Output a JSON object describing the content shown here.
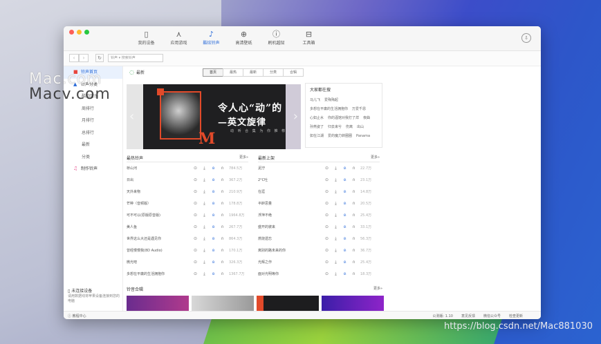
{
  "watermark": {
    "line1": "Mac.com",
    "line2": "Macv.com",
    "csdn": "https://blog.csdn.net/Mac881030"
  },
  "colors": {
    "accent": "#2a6bd9",
    "red": "#e24a2a"
  },
  "nav": [
    {
      "label": "我的设备",
      "icon": "phone-icon"
    },
    {
      "label": "应用游戏",
      "icon": "apps-icon"
    },
    {
      "label": "酷炫铃声",
      "icon": "music-note-icon",
      "active": true
    },
    {
      "label": "高清壁纸",
      "icon": "wallpaper-icon"
    },
    {
      "label": "刷机越狱",
      "icon": "flash-icon"
    },
    {
      "label": "工具箱",
      "icon": "toolbox-icon"
    }
  ],
  "toolbar": {
    "search_placeholder": "搜索铃声",
    "search_scope": "铃声"
  },
  "sidebar": {
    "items": [
      {
        "label": "铃声首页",
        "icon": "ringtone-icon",
        "selected": true
      },
      {
        "label": "铃声分类",
        "icon": "bell-icon"
      },
      {
        "label": "酷狗音乐",
        "sub": true
      },
      {
        "label": "周排行",
        "sub": true
      },
      {
        "label": "月排行",
        "sub": true
      },
      {
        "label": "总排行",
        "sub": true
      },
      {
        "label": "最新",
        "sub": true
      },
      {
        "label": "分类",
        "sub": true
      },
      {
        "label": "制作铃声",
        "icon": "make-ringtone-icon"
      }
    ],
    "device_title": "未连接设备",
    "device_desc": "请用数据线将苹果设备连接到您的电脑"
  },
  "filter_bar": {
    "latest": "最新",
    "filters": [
      "首页",
      "最热",
      "最新",
      "分类",
      "合辑"
    ]
  },
  "banner": {
    "title1": "令人心“动”的",
    "title2": "—英文旋律",
    "subtitle": "动 听 合 集  为 你 推 荐",
    "logo": "M"
  },
  "hot": {
    "title": "大家都在搜",
    "rows": [
      [
        "马儿飞",
        "爱殇殇起"
      ],
      [
        "多想在平庸的生活拥抱你",
        "万爱千恩"
      ],
      [
        "心如止水",
        "你的酒馆对我打了烊",
        "夜曲"
      ],
      [
        "孙燕姿了",
        "归去来兮",
        "伤离",
        "出山"
      ],
      [
        "如在江湖",
        "爱的魔力转圈圈",
        "Panama"
      ]
    ]
  },
  "hottest": {
    "title": "最热铃声",
    "more": "更多»",
    "songs": [
      {
        "name": "桥山河",
        "count": "784.5万"
      },
      {
        "name": "日出",
        "count": "367.2万"
      },
      {
        "name": "天外来物",
        "count": "210.9万"
      },
      {
        "name": "芒种（音频版）",
        "count": "178.8万"
      },
      {
        "name": "可不可以(原版原音版)",
        "count": "1964.8万"
      },
      {
        "name": "美人鱼",
        "count": "267.7万"
      },
      {
        "name": "世界这么大还是遇见你",
        "count": "864.3万"
      },
      {
        "name": "曾经慢慢我(8D Audio)",
        "count": "170.1万"
      },
      {
        "name": "微光吧",
        "count": "326.3万"
      },
      {
        "name": "多想在平庸的生活拥抱你",
        "count": "1367.7万"
      }
    ]
  },
  "newest": {
    "title": "最新上架",
    "more": "更多»",
    "songs": [
      {
        "name": "泥泞",
        "count": "22.7万"
      },
      {
        "name": "2°C吐",
        "count": "23.1万"
      },
      {
        "name": "在涯",
        "count": "14.8万"
      },
      {
        "name": "半醉思量",
        "count": "20.5万"
      },
      {
        "name": "浮萍不绝",
        "count": "25.4万"
      },
      {
        "name": "盛开的彼来",
        "count": "33.1万"
      },
      {
        "name": "燃烧遗忘",
        "count": "56.3万"
      },
      {
        "name": "离别的路未来的你",
        "count": "36.7万"
      },
      {
        "name": "光辉之作",
        "count": "25.4万"
      },
      {
        "name": "面对光明等你",
        "count": "18.3万"
      }
    ]
  },
  "recommend": {
    "title": "铃音合辑",
    "more": "更多»"
  },
  "status": {
    "help": "教程中心",
    "version": "公测版: 1.10",
    "feedback": "意见反馈",
    "wechat": "微信公众号",
    "update": "检查更新"
  }
}
